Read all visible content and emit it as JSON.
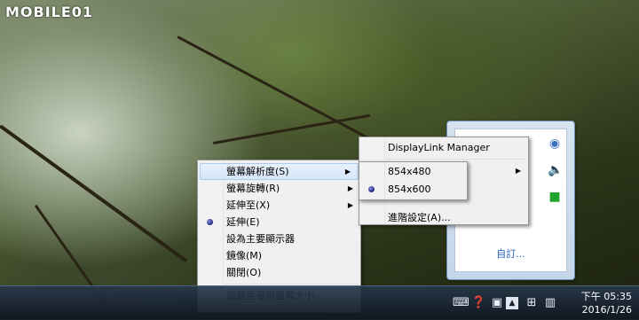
{
  "watermark": "MOBILE01",
  "context_menu": {
    "items": [
      {
        "label": "螢幕解析度(S)",
        "submenu": true,
        "highlighted": true,
        "checked": false
      },
      {
        "label": "螢幕旋轉(R)",
        "submenu": true,
        "highlighted": false,
        "checked": false
      },
      {
        "label": "延伸至(X)",
        "submenu": true,
        "highlighted": false,
        "checked": false
      },
      {
        "label": "延伸(E)",
        "submenu": false,
        "highlighted": false,
        "checked": true
      },
      {
        "label": "設為主要顯示器",
        "submenu": false,
        "highlighted": false,
        "checked": false
      },
      {
        "label": "鏡像(M)",
        "submenu": false,
        "highlighted": false,
        "checked": false
      },
      {
        "label": "關閉(O)",
        "submenu": false,
        "highlighted": false,
        "checked": false
      },
      {
        "label": "調整至電視螢幕大小...",
        "submenu": false,
        "highlighted": false,
        "checked": false
      }
    ]
  },
  "resolution_submenu": {
    "items": [
      {
        "label": "854x480",
        "checked": false
      },
      {
        "label": "854x600",
        "checked": true
      }
    ]
  },
  "displaylink_menu": {
    "title": "DisplayLink Manager",
    "advanced": "進階設定(A)..."
  },
  "tray_popup": {
    "customize": "自訂..."
  },
  "clock": {
    "time": "下午 05:35",
    "date": "2016/1/26"
  }
}
